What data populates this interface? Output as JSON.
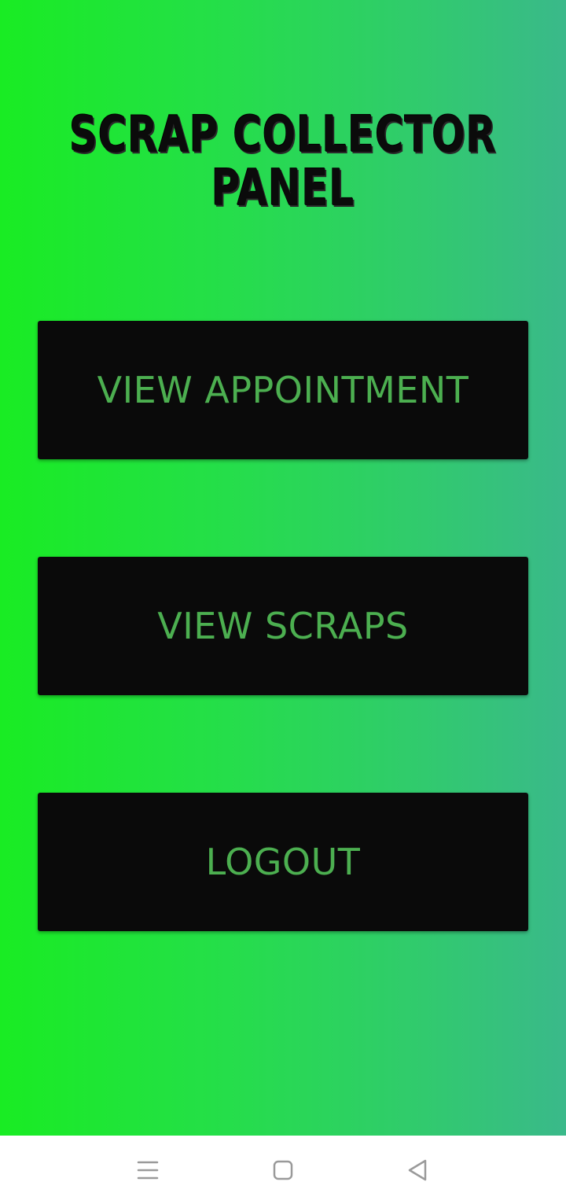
{
  "panel": {
    "title_line1": "SCRAP COLLECTOR",
    "title_line2": "PANEL"
  },
  "buttons": {
    "view_appointment": "VIEW APPOINTMENT",
    "view_scraps": "VIEW SCRAPS",
    "logout": "LOGOUT"
  },
  "navigation": {
    "icons": [
      "menu-icon",
      "home-icon",
      "back-icon"
    ]
  },
  "colors": {
    "gradient_start": "#19ec23",
    "gradient_end": "#3ab98a",
    "button_background": "#0a0a0a",
    "button_text": "#4caf50"
  }
}
